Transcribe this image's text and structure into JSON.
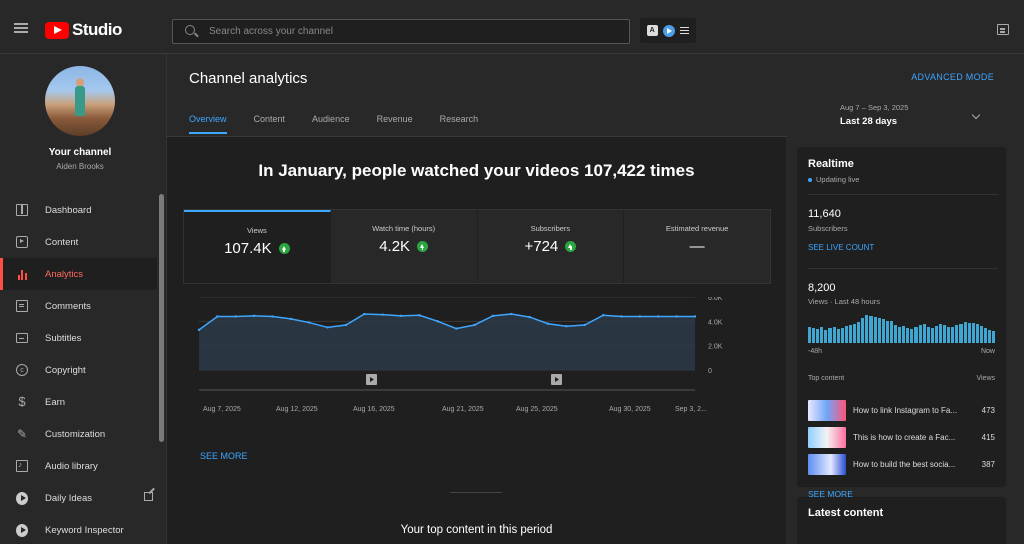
{
  "app": {
    "name": "Studio",
    "search_placeholder": "Search across your channel"
  },
  "sidebar": {
    "channel_label": "Your channel",
    "channel_owner": "Aiden Brooks",
    "items": [
      {
        "label": "Dashboard",
        "icon": "dashboard-icon"
      },
      {
        "label": "Content",
        "icon": "content-icon"
      },
      {
        "label": "Analytics",
        "icon": "analytics-icon",
        "active": true
      },
      {
        "label": "Comments",
        "icon": "comments-icon"
      },
      {
        "label": "Subtitles",
        "icon": "subtitles-icon"
      },
      {
        "label": "Copyright",
        "icon": "copyright-icon"
      },
      {
        "label": "Earn",
        "icon": "earn-icon"
      },
      {
        "label": "Customization",
        "icon": "customization-icon"
      },
      {
        "label": "Audio library",
        "icon": "audio-library-icon"
      },
      {
        "label": "Daily Ideas",
        "icon": "tubebuddy-icon"
      },
      {
        "label": "Keyword Inspector",
        "icon": "tubebuddy-icon"
      }
    ]
  },
  "header": {
    "title": "Channel analytics",
    "advanced_mode": "ADVANCED MODE",
    "tabs": [
      "Overview",
      "Content",
      "Audience",
      "Revenue",
      "Research"
    ],
    "date_range": "Aug 7 – Sep 3, 2025",
    "date_label": "Last 28 days"
  },
  "overview": {
    "headline": "In January, people watched your videos 107,422 times",
    "metrics": [
      {
        "title": "Views",
        "value": "107.4K",
        "trend": "up"
      },
      {
        "title": "Watch time (hours)",
        "value": "4.2K",
        "trend": "up"
      },
      {
        "title": "Subscribers",
        "value": "+724",
        "trend": "up"
      },
      {
        "title": "Estimated revenue",
        "value": "—",
        "trend": "none"
      }
    ],
    "see_more": "SEE MORE",
    "top_content_title": "Your top content in this period"
  },
  "chart_data": {
    "type": "area",
    "series": [
      {
        "values": [
          3300,
          4400,
          4400,
          4450,
          4400,
          4200,
          3900,
          3500,
          3700,
          4600,
          4550,
          4450,
          4500,
          4000,
          3400,
          3700,
          4450,
          4600,
          4350,
          3800,
          3600,
          3700,
          4500,
          4400,
          4400,
          4400,
          4400,
          4400
        ]
      }
    ],
    "x_tick_labels": [
      "Aug 7, 2025",
      "Aug 12, 2025",
      "Aug 16, 2025",
      "Aug 21, 2025",
      "Aug 25, 2025",
      "Aug 30, 2025",
      "Sep 3, 2..."
    ],
    "y_tick_labels": [
      "6.0K",
      "4.0K",
      "2.0K",
      "0"
    ],
    "ylim": [
      0,
      6000
    ],
    "grid": true,
    "line_color": "#3ea6ff"
  },
  "realtime": {
    "title": "Realtime",
    "status": "Updating live",
    "subscribers": "11,640",
    "subscribers_label": "Subscribers",
    "see_live_count": "SEE LIVE COUNT",
    "views": "8,200",
    "views_label": "Views · Last 48 hours",
    "bars": [
      0.55,
      0.5,
      0.48,
      0.52,
      0.45,
      0.5,
      0.55,
      0.48,
      0.5,
      0.58,
      0.6,
      0.65,
      0.7,
      0.85,
      0.95,
      0.9,
      0.88,
      0.85,
      0.8,
      0.75,
      0.72,
      0.6,
      0.55,
      0.58,
      0.5,
      0.48,
      0.55,
      0.6,
      0.62,
      0.55,
      0.5,
      0.58,
      0.62,
      0.6,
      0.52,
      0.55,
      0.6,
      0.65,
      0.7,
      0.68,
      0.66,
      0.62,
      0.58,
      0.5,
      0.45,
      0.4
    ],
    "axis_left": "-48h",
    "axis_right": "Now",
    "top_content_label": "Top content",
    "views_col_label": "Views",
    "top_items": [
      {
        "title": "How to link Instagram to Fa...",
        "views": "473"
      },
      {
        "title": "This is how to create a Fac...",
        "views": "415"
      },
      {
        "title": "How to build the best socia...",
        "views": "387"
      }
    ],
    "see_more": "SEE MORE"
  },
  "latest": {
    "title": "Latest content"
  }
}
